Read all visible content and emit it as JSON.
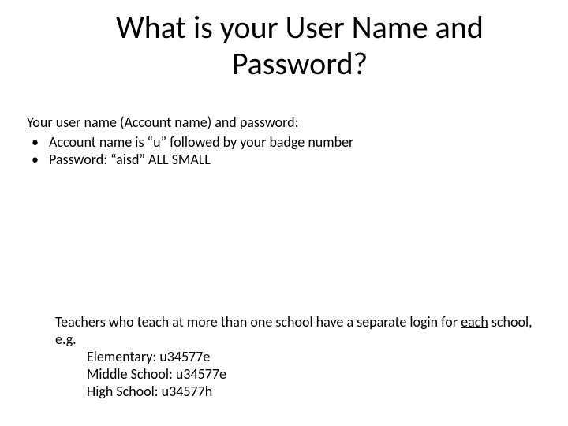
{
  "title": "What is your User Name and Password?",
  "intro": "Your user name (Account name) and password:",
  "bullets": [
    "Account name is “u” followed by your badge number",
    "Password: “aisd” ALL SMALL"
  ],
  "note_pre": "Teachers who teach at more than one school have a separate login for ",
  "note_underlined": "each",
  "note_post": " school, e.g.",
  "examples": [
    "Elementary: u34577e",
    "Middle School: u34577e",
    "High School: u34577h"
  ]
}
